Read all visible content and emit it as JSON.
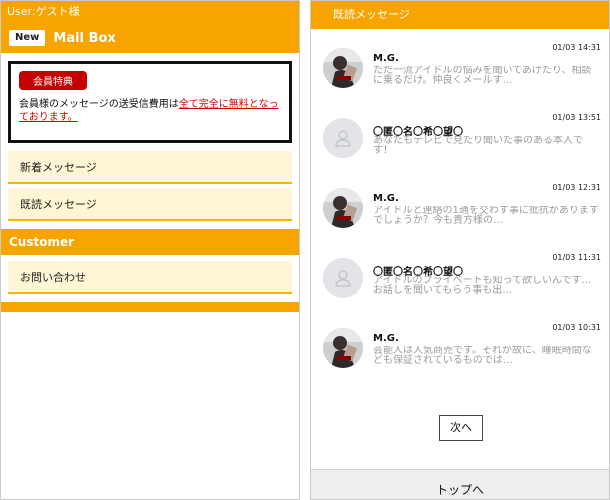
{
  "left": {
    "user_label": "User:ゲスト様",
    "new_badge": "New",
    "mailbox_title": "Mail Box",
    "notice": {
      "tag": "会員特典",
      "text": "会員様のメッセージの送受信費用は",
      "link": "全て完全に無料となっております。"
    },
    "menu": [
      {
        "label": "新着メッセージ"
      },
      {
        "label": "既読メッセージ"
      }
    ],
    "customer_header": "Customer",
    "customer_menu": [
      {
        "label": "お問い合わせ"
      }
    ]
  },
  "right": {
    "header": "既読メッセージ",
    "messages": [
      {
        "date": "01/03 14:31",
        "sender": "M.G.",
        "preview": "ただ一流アイドルの悩みを聞いてあげたり、相談に乗るだけ。仲良くメールす…",
        "avatar": "photo"
      },
      {
        "date": "01/03 13:51",
        "sender": "〇匿〇名〇希〇望〇",
        "preview": "あなたもテレビで見たり聞いた事のある本人です！",
        "avatar": "default"
      },
      {
        "date": "01/03 12:31",
        "sender": "M.G.",
        "preview": "アイドルと連絡の1通を交わす事に批抗がありますでしょうか？今も貴方様の…",
        "avatar": "photo"
      },
      {
        "date": "01/03 11:31",
        "sender": "〇匿〇名〇希〇望〇",
        "preview": "アイドルのプライベートも知って欲しいんです…お話しを聞いてもらう事も出…",
        "avatar": "default"
      },
      {
        "date": "01/03 10:31",
        "sender": "M.G.",
        "preview": "芸能人は人気商売です。それが故に、睡眠時間なども保証されているものでは…",
        "avatar": "photo"
      }
    ],
    "next_button": "次へ",
    "top_link": "トップへ"
  }
}
